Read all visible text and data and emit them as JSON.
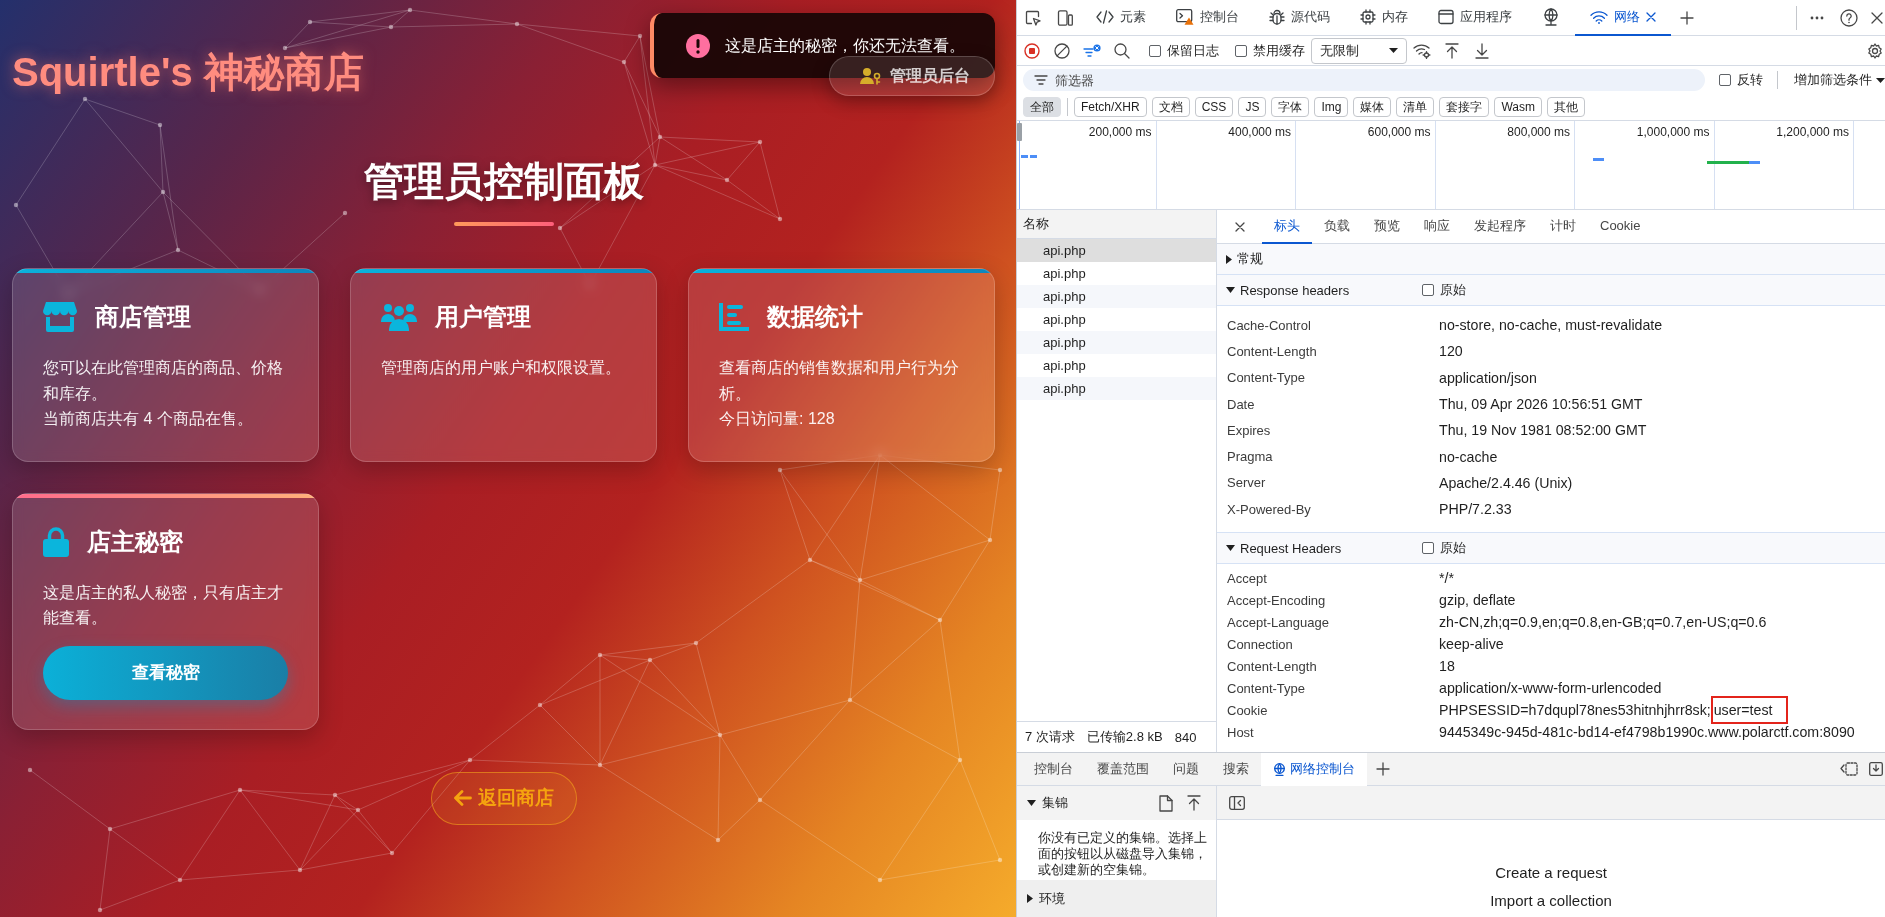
{
  "shop": {
    "brand": "Squirtle's 神秘商店",
    "admin_button": "管理员后台",
    "toast": {
      "message": "这是店主的秘密，你还无法查看。"
    },
    "heading": "管理员控制面板",
    "cards": [
      {
        "kind": "info",
        "title": "商店管理",
        "paragraphs": [
          "您可以在此管理商店的商品、价格和库存。",
          "当前商店共有 4 个商品在售。"
        ]
      },
      {
        "kind": "info",
        "title": "用户管理",
        "paragraphs": [
          "管理商店的用户账户和权限设置。"
        ]
      },
      {
        "kind": "info",
        "title": "数据统计",
        "paragraphs": [
          "查看商店的销售数据和用户行为分析。",
          "今日访问量: 128"
        ]
      },
      {
        "kind": "locked",
        "title": "店主秘密",
        "paragraphs": [
          "这是店主的私人秘密，只有店主才能查看。"
        ],
        "button": "查看秘密"
      }
    ],
    "back_button": "返回商店"
  },
  "devtools": {
    "panel_tabs": [
      {
        "label": "元素",
        "selected": false
      },
      {
        "label": "控制台",
        "selected": false
      },
      {
        "label": "源代码",
        "selected": false
      },
      {
        "label": "内存",
        "selected": false
      },
      {
        "label": "应用程序",
        "selected": false
      },
      {
        "selected": false
      },
      {
        "label": "网络",
        "selected": true
      }
    ],
    "toolbar": {
      "preserve_log": {
        "label": "保留日志",
        "checked": false
      },
      "disable_cache": {
        "label": "禁用缓存",
        "checked": false
      },
      "throttling": {
        "value": "无限制"
      }
    },
    "filter": {
      "placeholder": "筛选器",
      "invert": {
        "label": "反转",
        "checked": false
      },
      "more_filters": "增加筛选条件"
    },
    "type_filters": [
      {
        "label": "全部",
        "selected": true
      },
      {
        "label": "Fetch/XHR",
        "selected": false
      },
      {
        "label": "文档",
        "selected": false
      },
      {
        "label": "CSS",
        "selected": false
      },
      {
        "label": "JS",
        "selected": false
      },
      {
        "label": "字体",
        "selected": false
      },
      {
        "label": "Img",
        "selected": false
      },
      {
        "label": "媒体",
        "selected": false
      },
      {
        "label": "清单",
        "selected": false
      },
      {
        "label": "套接字",
        "selected": false
      },
      {
        "label": "Wasm",
        "selected": false
      },
      {
        "label": "其他",
        "selected": false
      }
    ],
    "timeline": {
      "ticks": [
        "200,000 ms",
        "400,000 ms",
        "600,000 ms",
        "800,000 ms",
        "1,000,000 ms",
        "1,200,000 ms"
      ]
    },
    "requests": {
      "column": "名称",
      "rows": [
        {
          "name": "api.php",
          "selected": true
        },
        {
          "name": "api.php",
          "selected": false
        },
        {
          "name": "api.php",
          "selected": false
        },
        {
          "name": "api.php",
          "selected": false
        },
        {
          "name": "api.php",
          "selected": false
        },
        {
          "name": "api.php",
          "selected": false
        },
        {
          "name": "api.php",
          "selected": false
        }
      ],
      "status_bar": [
        "7 次请求",
        "已传输2.8 kB",
        "840"
      ]
    },
    "detail": {
      "tabs": [
        {
          "label": "标头",
          "selected": true
        },
        {
          "label": "负载",
          "selected": false
        },
        {
          "label": "预览",
          "selected": false
        },
        {
          "label": "响应",
          "selected": false
        },
        {
          "label": "发起程序",
          "selected": false
        },
        {
          "label": "计时",
          "selected": false
        },
        {
          "label": "Cookie",
          "selected": false
        }
      ],
      "sections": [
        {
          "title": "常规",
          "expanded": false
        },
        {
          "title": "Response headers",
          "expanded": true,
          "raw": {
            "label": "原始",
            "checked": false
          },
          "headers": [
            {
              "name": "Cache-Control",
              "value": "no-store, no-cache, must-revalidate"
            },
            {
              "name": "Content-Length",
              "value": "120"
            },
            {
              "name": "Content-Type",
              "value": "application/json"
            },
            {
              "name": "Date",
              "value": "Thu, 09 Apr 2026 10:56:51 GMT"
            },
            {
              "name": "Expires",
              "value": "Thu, 19 Nov 1981 08:52:00 GMT"
            },
            {
              "name": "Pragma",
              "value": "no-cache"
            },
            {
              "name": "Server",
              "value": "Apache/2.4.46 (Unix)"
            },
            {
              "name": "X-Powered-By",
              "value": "PHP/7.2.33"
            }
          ]
        },
        {
          "title": "Request Headers",
          "expanded": true,
          "raw": {
            "label": "原始",
            "checked": false
          },
          "headers": [
            {
              "name": "Accept",
              "value": "*/*"
            },
            {
              "name": "Accept-Encoding",
              "value": "gzip, deflate"
            },
            {
              "name": "Accept-Language",
              "value": "zh-CN,zh;q=0.9,en;q=0.8,en-GB;q=0.7,en-US;q=0.6"
            },
            {
              "name": "Connection",
              "value": "keep-alive"
            },
            {
              "name": "Content-Length",
              "value": "18"
            },
            {
              "name": "Content-Type",
              "value": "application/x-www-form-urlencoded"
            },
            {
              "name": "Cookie",
              "value": "PHPSESSID=h7dqupl78nes53hitnhjhrr8sk;",
              "annotation": "user=test"
            },
            {
              "name": "Host",
              "value": "9445349c-945d-481c-bd14-ef4798b1990c.www.polarctf.com:8090"
            }
          ]
        }
      ]
    },
    "drawer": {
      "tabs": [
        {
          "label": "控制台",
          "selected": false
        },
        {
          "label": "覆盖范围",
          "selected": false
        },
        {
          "label": "问题",
          "selected": false
        },
        {
          "label": "搜索",
          "selected": false
        },
        {
          "label": "网络控制台",
          "selected": true
        }
      ],
      "sidebar": [
        {
          "title": "集锦",
          "expanded": true,
          "text": "你没有已定义的集锦。选择上面的按钮以从磁盘导入集锦，或创建新的空集锦。"
        },
        {
          "title": "环境",
          "expanded": false
        }
      ],
      "links": [
        "Create a request",
        "Import a collection"
      ]
    }
  }
}
